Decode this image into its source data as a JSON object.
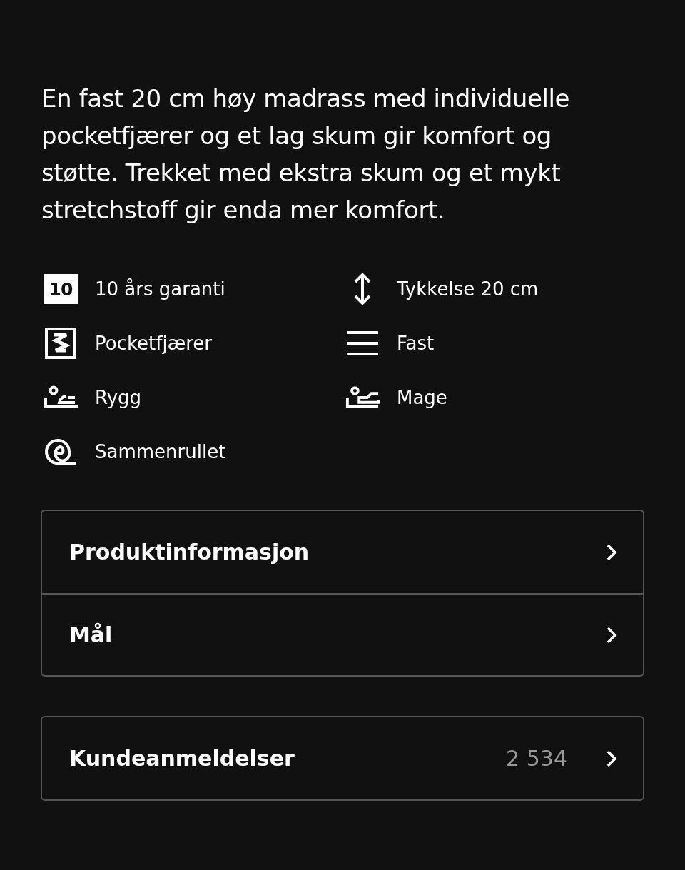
{
  "description": "En fast 20 cm høy madrass med individuelle pocketfjærer og et lag skum gir komfort og støtte. Trekket med ekstra skum og et mykt stretchstoff gir enda mer komfort.",
  "features": [
    {
      "kind": "warranty",
      "badge": "10",
      "label": "10 års garanti"
    },
    {
      "kind": "height",
      "label": "Tykkelse 20 cm"
    },
    {
      "kind": "springs",
      "label": "Pocketfjærer"
    },
    {
      "kind": "firmness",
      "label": "Fast"
    },
    {
      "kind": "back",
      "label": "Rygg"
    },
    {
      "kind": "stomach",
      "label": "Mage"
    },
    {
      "kind": "rolled",
      "label": "Sammenrullet"
    }
  ],
  "sections": [
    {
      "rows": [
        {
          "title": "Produktinformasjon"
        },
        {
          "title": "Mål"
        }
      ]
    },
    {
      "rows": [
        {
          "title": "Kundeanmeldelser",
          "count": "2 534"
        }
      ]
    }
  ]
}
